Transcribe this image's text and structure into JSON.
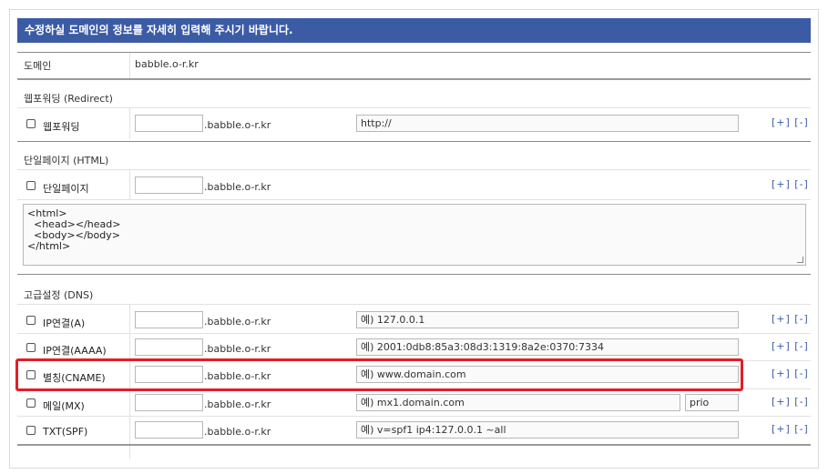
{
  "header": {
    "title": "수정하실 도메인의 정보를 자세히 입력해 주시기 바랍니다."
  },
  "domain": {
    "label": "도메인",
    "value": "babble.o-r.kr"
  },
  "sections": {
    "redirect": {
      "title": "웹포워딩 (Redirect)"
    },
    "html": {
      "title": "단일페이지 (HTML)"
    },
    "dns": {
      "title": "고급설정 (DNS)"
    }
  },
  "rows": {
    "redirect": {
      "label": "웹포워딩",
      "suffix": ".babble.o-r.kr",
      "value": "http://",
      "actions": "[+] [-]"
    },
    "html": {
      "label": "단일페이지",
      "suffix": ".babble.o-r.kr",
      "actions": "[+] [-]"
    },
    "a": {
      "label": "IP연결(A)",
      "suffix": ".babble.o-r.kr",
      "placeholder": "예) 127.0.0.1",
      "actions": "[+] [-]"
    },
    "aaaa": {
      "label": "IP연결(AAAA)",
      "suffix": ".babble.o-r.kr",
      "placeholder": "예) 2001:0db8:85a3:08d3:1319:8a2e:0370:7334",
      "actions": "[+] [-]"
    },
    "cname": {
      "label": "별칭(CNAME)",
      "suffix": ".babble.o-r.kr",
      "placeholder": "예) www.domain.com",
      "actions": "[+] [-]"
    },
    "mx": {
      "label": "메일(MX)",
      "suffix": ".babble.o-r.kr",
      "placeholder": "예) mx1.domain.com",
      "prio_placeholder": "prio",
      "actions": "[+] [-]"
    },
    "txt": {
      "label": "TXT(SPF)",
      "suffix": ".babble.o-r.kr",
      "placeholder": "예) v=spf1 ip4:127.0.0.1 ~all",
      "actions": "[+] [-]"
    }
  },
  "html_editor": {
    "value": "<html>\n  <head></head>\n  <body></body>\n</html>"
  },
  "colors": {
    "header_bg": "#3b5ba5",
    "highlight": "#e21e26",
    "link": "#3b5ba5"
  }
}
